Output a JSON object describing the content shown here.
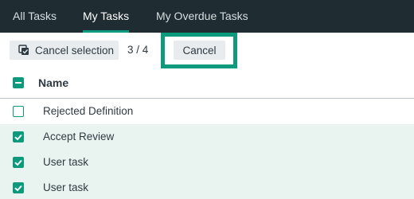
{
  "nav": {
    "tabs": [
      {
        "label": "All Tasks",
        "active": false
      },
      {
        "label": "My Tasks",
        "active": true
      },
      {
        "label": "My Overdue Tasks",
        "active": false
      }
    ]
  },
  "toolbar": {
    "cancel_selection_label": "Cancel selection",
    "cancel_selection_icon": "deselect-icon",
    "selection_count": "3 / 4",
    "cancel_label": "Cancel"
  },
  "table": {
    "header": {
      "name_label": "Name",
      "select_all_state": "indeterminate"
    },
    "rows": [
      {
        "name": "Rejected Definition",
        "selected": false
      },
      {
        "name": "Accept Review",
        "selected": true
      },
      {
        "name": "User task",
        "selected": true
      },
      {
        "name": "User task",
        "selected": true
      }
    ]
  },
  "colors": {
    "nav_background": "#1f2d33",
    "accent": "#0c9a7d",
    "selected_row": "#e9f4f1",
    "button_background": "#e8ecee"
  }
}
